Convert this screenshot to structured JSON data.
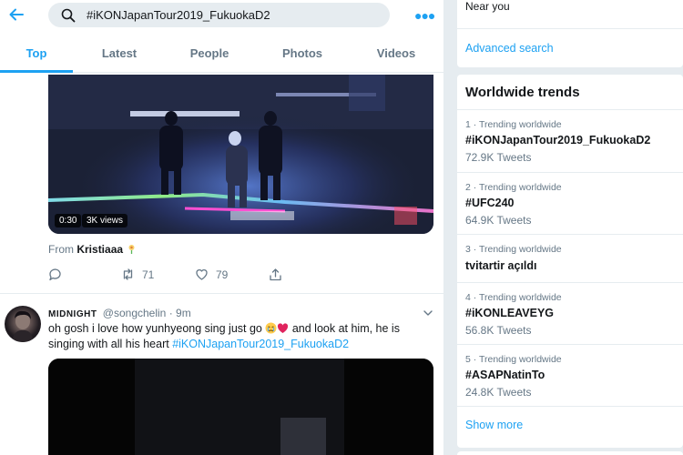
{
  "search": {
    "query": "#iKONJapanTour2019_FukuokaD2"
  },
  "tabs": [
    {
      "label": "Top"
    },
    {
      "label": "Latest"
    },
    {
      "label": "People"
    },
    {
      "label": "Photos"
    },
    {
      "label": "Videos"
    }
  ],
  "tweet1": {
    "video_duration": "0:30",
    "video_views": "3K views",
    "from_prefix": "From ",
    "from_name": "Kristiaaa",
    "retweets": "71",
    "likes": "79"
  },
  "tweet2": {
    "display_name": "MIDNIGHT",
    "handle": "@songchelin",
    "separator": "·",
    "time": "9m",
    "text_part1": "oh gosh i love how yunhyeong sing just go ",
    "text_part2": " and look at him, he is singing with all his heart ",
    "hashtag": "#iKONJapanTour2019_FukuokaD2"
  },
  "sidebar": {
    "near_you": "Near you",
    "advanced_search": "Advanced search",
    "trends_title": "Worldwide trends",
    "trends": [
      {
        "meta": "1 · Trending worldwide",
        "name": "#iKONJapanTour2019_FukuokaD2",
        "count": "72.9K Tweets"
      },
      {
        "meta": "2 · Trending worldwide",
        "name": "#UFC240",
        "count": "64.9K Tweets"
      },
      {
        "meta": "3 · Trending worldwide",
        "name": "tvitartir açıldı",
        "count": ""
      },
      {
        "meta": "4 · Trending worldwide",
        "name": "#iKONLEAVEYG",
        "count": "56.8K Tweets"
      },
      {
        "meta": "5 · Trending worldwide",
        "name": "#ASAPNatinTo",
        "count": "24.8K Tweets"
      }
    ],
    "show_more": "Show more"
  },
  "colors": {
    "accent": "#1da1f2",
    "text": "#14171a",
    "muted": "#657786",
    "background": "#e6ecf0"
  }
}
